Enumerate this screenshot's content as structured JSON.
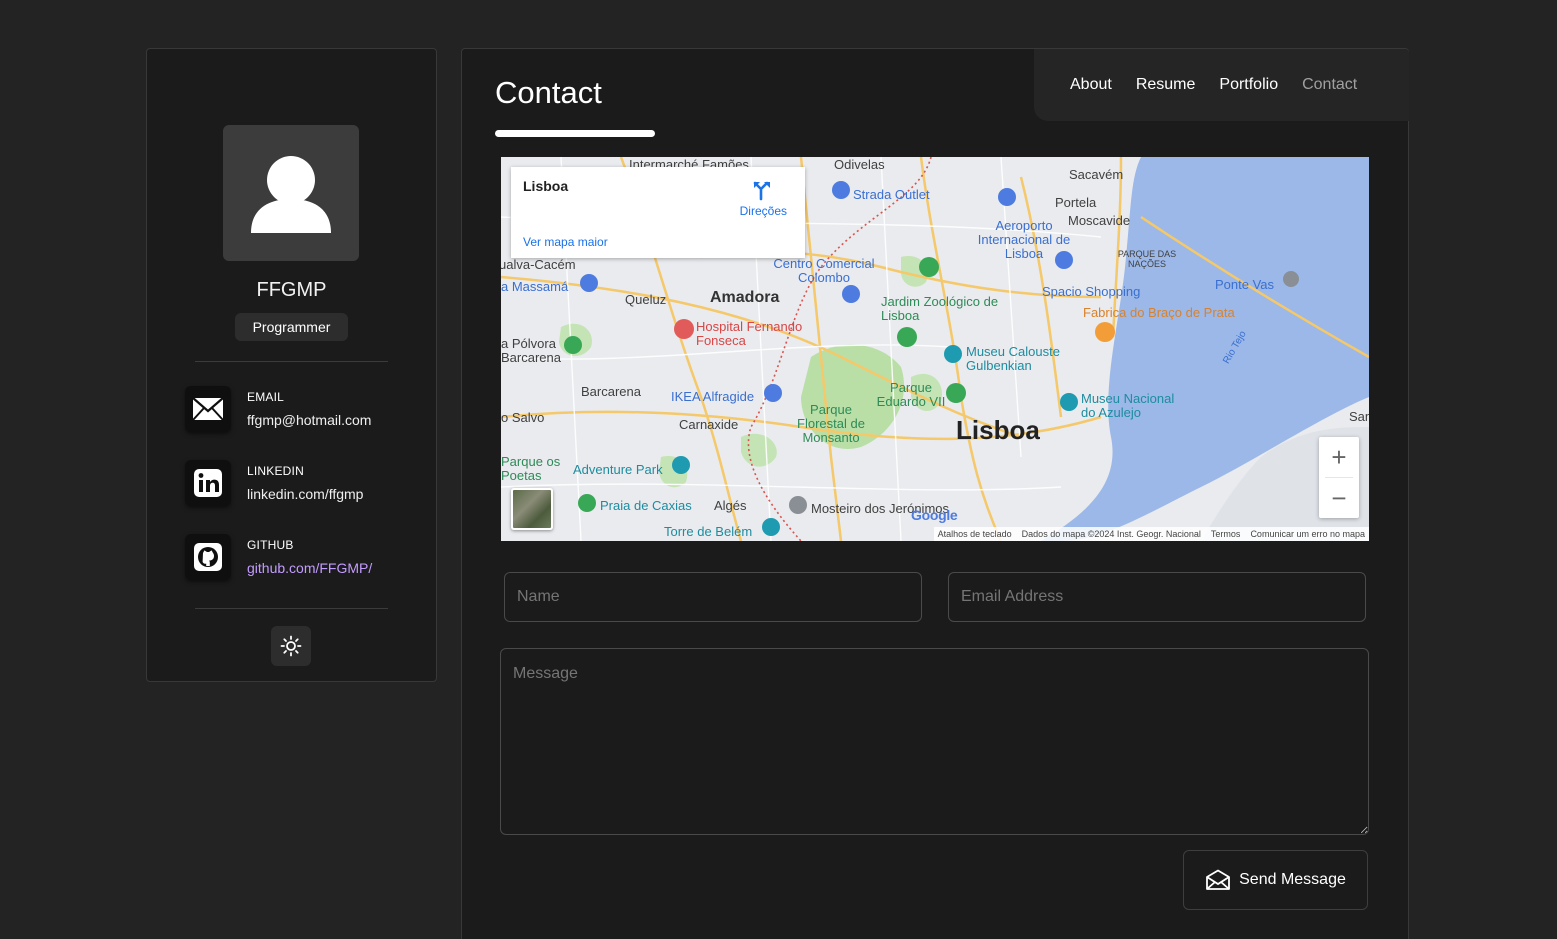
{
  "profile": {
    "name": "FFGMP",
    "role": "Programmer"
  },
  "contacts": [
    {
      "label": "EMAIL",
      "value": "ffgmp@hotmail.com",
      "icon": "mail-icon"
    },
    {
      "label": "LINKEDIN",
      "value": "linkedin.com/ffgmp",
      "icon": "linkedin-icon"
    },
    {
      "label": "GITHUB",
      "value": "github.com/FFGMP/",
      "icon": "github-icon"
    }
  ],
  "theme_toggle_icon": "sun-icon",
  "page": {
    "title": "Contact"
  },
  "nav": [
    {
      "label": "About"
    },
    {
      "label": "Resume"
    },
    {
      "label": "Portfolio"
    },
    {
      "label": "Contact",
      "active": true
    }
  ],
  "map": {
    "card_title": "Lisboa",
    "directions": "Direções",
    "bigger_map": "Ver mapa maior",
    "labels": {
      "lisboa": "Lisboa",
      "amadora": "Amadora",
      "queluz": "Queluz",
      "barcarena": "Barcarena",
      "carnaxide": "Carnaxide",
      "alges": "Algés",
      "sacavem": "Sacavém",
      "portela": "Portela",
      "moscavide": "Moscavide",
      "airport": "Aeroporto Internacional de Lisboa",
      "strada": "Strada Outlet",
      "colombo": "Centro Comercial Colombo",
      "zoo": "Jardim Zoológico de Lisboa",
      "spacio": "Spacio Shopping",
      "fabrica": "Fabrica do Braço de Prata",
      "gulbenkian": "Museu Calouste Gulbenkian",
      "eduardo": "Parque Eduardo VII",
      "monsanto": "Parque Florestal de Monsanto",
      "hospital": "Hospital Fernando Fonseca",
      "ikea": "IKEA Alfragide",
      "adventure": "Adventure Park",
      "caxias": "Praia de Caxias",
      "azulejo": "Museu Nacional do Azulejo",
      "jeronimos": "Mosteiro dos Jerónimos",
      "belem": "Torre de Belém",
      "rio": "Rio Tejo",
      "ponte": "Ponte Vas",
      "massama": "a Massamá",
      "polvora": "a Pólvora Barcarena",
      "cacem": "ualva-Cacém",
      "salvo": "o Salvo",
      "poetas": "Parque os Poetas",
      "nacoes": "PARQUE DAS NAÇÕES",
      "odivelas": "Odivelas",
      "famoes": "Intermarché Famões",
      "sam": "Sam"
    },
    "google": "Google",
    "attribution": [
      "Atalhos de teclado",
      "Dados do mapa ©2024 Inst. Geogr. Nacional",
      "Termos",
      "Comunicar um erro no mapa"
    ],
    "zoom_in": "+",
    "zoom_out": "−"
  },
  "form": {
    "name_placeholder": "Name",
    "email_placeholder": "Email Address",
    "message_placeholder": "Message",
    "send_label": "Send Message"
  },
  "colors": {
    "background": "#232323",
    "panel": "#1b1b1b",
    "link": "#c39cff",
    "water": "#9bb8e8"
  }
}
